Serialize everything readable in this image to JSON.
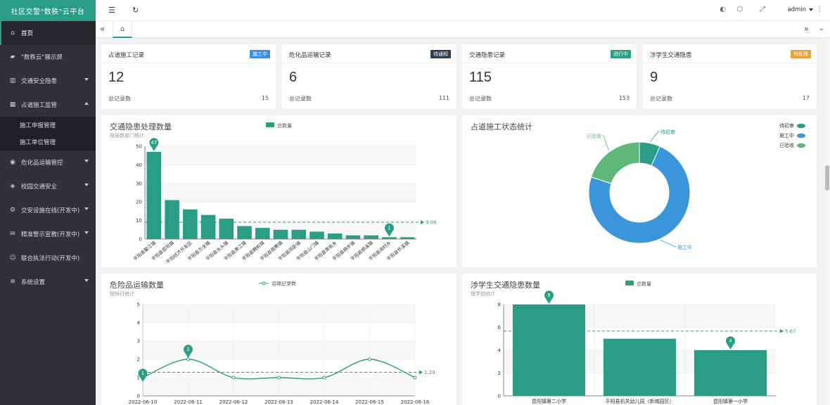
{
  "app": {
    "title": "社区交警\"数秩\"云平台"
  },
  "header": {
    "user": "admin"
  },
  "sidebar": {
    "items": [
      {
        "label": "首页",
        "icon": "home-icon"
      },
      {
        "label": "\"数秩云\"展示屏",
        "icon": "screen-icon"
      },
      {
        "label": "交通安全隐患",
        "icon": "grid-icon"
      },
      {
        "label": "占道施工监管",
        "icon": "building-icon"
      },
      {
        "label": "危化品运输管控",
        "icon": "location-icon"
      },
      {
        "label": "校园交通安全",
        "icon": "shield-icon"
      },
      {
        "label": "交安设施在线(开发中)",
        "icon": "settings-icon"
      },
      {
        "label": "精准警示宣教(开发中)",
        "icon": "chat-icon"
      },
      {
        "label": "联合执法行动(开发中)",
        "icon": "person-icon"
      },
      {
        "label": "系统设置",
        "icon": "gear-icon"
      }
    ],
    "submenu": [
      "施工申报管理",
      "施工单位管理"
    ]
  },
  "stats": [
    {
      "title": "占道施工记录",
      "badge": "施工中",
      "badge_color": "#3a8ee6",
      "value": "12",
      "sub_label": "总记录数",
      "sub_value": "15"
    },
    {
      "title": "危化品运输记录",
      "badge": "待通知",
      "badge_color": "#2c3e50",
      "value": "6",
      "sub_label": "总记录数",
      "sub_value": "111"
    },
    {
      "title": "交通隐患记录",
      "badge": "进行中",
      "badge_color": "#2a9d86",
      "value": "115",
      "sub_label": "总记录数",
      "sub_value": "153"
    },
    {
      "title": "涉学生交通隐患",
      "badge": "待处理",
      "badge_color": "#e6a23c",
      "value": "9",
      "sub_label": "总记录数",
      "sub_value": "17"
    }
  ],
  "chart_data": [
    {
      "type": "bar",
      "title": "交通隐患处理数量",
      "subtitle": "按报数部门统计",
      "legend": [
        "总数量"
      ],
      "categories": [
        "平阳县鳌江镇",
        "平阳县昆阳镇",
        "平阳经济开发区",
        "平阳县万全镇",
        "平阳县水头镇",
        "平阳县萧江镇",
        "平阳县腾蛟镇",
        "平阳县南麂镇",
        "平阳县凤卧镇",
        "平阳县山门镇",
        "平阳县青街乡",
        "平阳县麻步镇",
        "平阳县顺溪镇",
        "平阳县闹村乡",
        "平阳县怀溪镇"
      ],
      "values": [
        47,
        21,
        16,
        13,
        11,
        7,
        6,
        5,
        5,
        4,
        3,
        2,
        2,
        1,
        1
      ],
      "ylim": [
        0,
        50
      ],
      "yticks": [
        "0",
        "10",
        "20",
        "30",
        "40",
        "50"
      ],
      "average": 9.06,
      "average_label": "9.06",
      "max_label": "47",
      "min_label": "1",
      "color": "#2a9d86"
    },
    {
      "type": "pie",
      "title": "占道施工状态统计",
      "labels": [
        "待初审",
        "施工中",
        "已验收"
      ],
      "values": [
        1,
        11,
        3
      ],
      "colors": [
        "#2a9d86",
        "#3a96d8",
        "#5fb878"
      ]
    },
    {
      "type": "line",
      "title": "危险品运输数量",
      "subtitle": "按照日统计",
      "legend": [
        "运输记录数"
      ],
      "categories": [
        "2022-06-10",
        "2022-06-11",
        "2022-06-12",
        "2022-06-13",
        "2022-06-14",
        "2022-06-15",
        "2022-06-16"
      ],
      "values": [
        1,
        2,
        1,
        1,
        1,
        2,
        1
      ],
      "ylim": [
        0,
        5
      ],
      "yticks": [
        "0",
        "1",
        "2",
        "3",
        "4",
        "5"
      ],
      "average": 1.29,
      "average_label": "1.29",
      "max_label": "2",
      "min_label": "1",
      "color": "#2a9d86"
    },
    {
      "type": "bar",
      "title": "涉学生交通隐患数量",
      "subtitle": "按学校统计",
      "legend": [
        "总数量"
      ],
      "categories": [
        "昆阳镇第二小学",
        "平阳县机关幼儿园（新城园区）",
        "昆阳镇第一小学"
      ],
      "values": [
        8,
        5,
        4
      ],
      "ylim": [
        0,
        8
      ],
      "yticks": [
        "0",
        "2",
        "4",
        "6",
        "8"
      ],
      "average": 5.67,
      "average_label": "5.67",
      "max_label": "8",
      "min_label": "4",
      "color": "#2a9d86"
    }
  ]
}
